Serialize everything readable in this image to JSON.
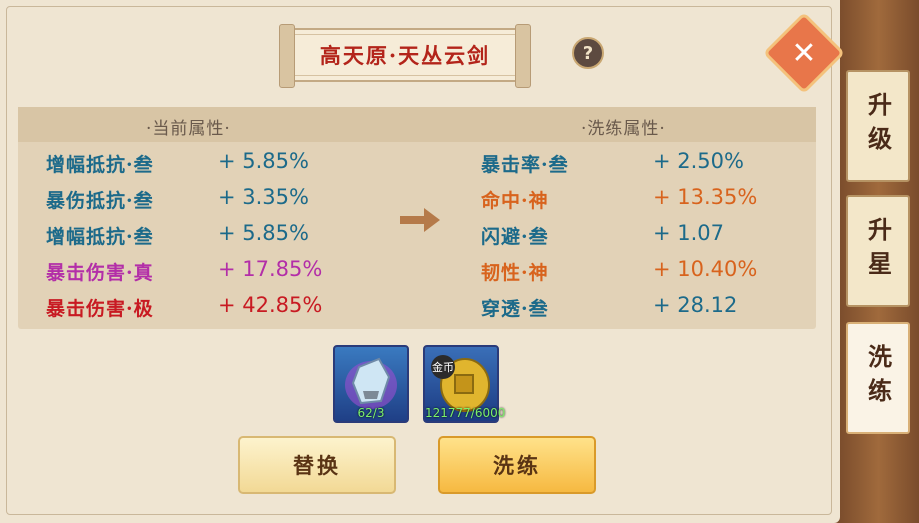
{
  "title": "高天原·天丛云剑",
  "help_icon": "?",
  "current_header": "当前属性",
  "wash_header": "洗练属性",
  "current_attrs": [
    {
      "name": "增幅抵抗·叁",
      "value": "+ 5.85%",
      "color": "#1c6a8a"
    },
    {
      "name": "暴伤抵抗·叁",
      "value": "+ 3.35%",
      "color": "#1c6a8a"
    },
    {
      "name": "增幅抵抗·叁",
      "value": "+ 5.85%",
      "color": "#1c6a8a"
    },
    {
      "name": "暴击伤害·真",
      "value": "+ 17.85%",
      "color": "#b32ea8"
    },
    {
      "name": "暴击伤害·极",
      "value": "+ 42.85%",
      "color": "#c81a22"
    }
  ],
  "wash_attrs": [
    {
      "name": "暴击率·叁",
      "value": "+ 2.50%",
      "color": "#1c6a8a"
    },
    {
      "name": "命中·神",
      "value": "+ 13.35%",
      "color": "#d8631d"
    },
    {
      "name": "闪避·叁",
      "value": "+ 1.07",
      "color": "#1c6a8a"
    },
    {
      "name": "韧性·神",
      "value": "+ 10.40%",
      "color": "#d8631d"
    },
    {
      "name": "穿透·叁",
      "value": "+ 28.12",
      "color": "#1c6a8a"
    }
  ],
  "items": [
    {
      "icon": "crystal-stone-icon",
      "count": "62/3"
    },
    {
      "icon": "gold-coin-icon",
      "label": "金币",
      "count": "121777/6000"
    }
  ],
  "buttons": {
    "replace": "替换",
    "wash": "洗练"
  },
  "side_tabs": [
    "升级",
    "升星",
    "洗练"
  ],
  "close_icon": "✕"
}
